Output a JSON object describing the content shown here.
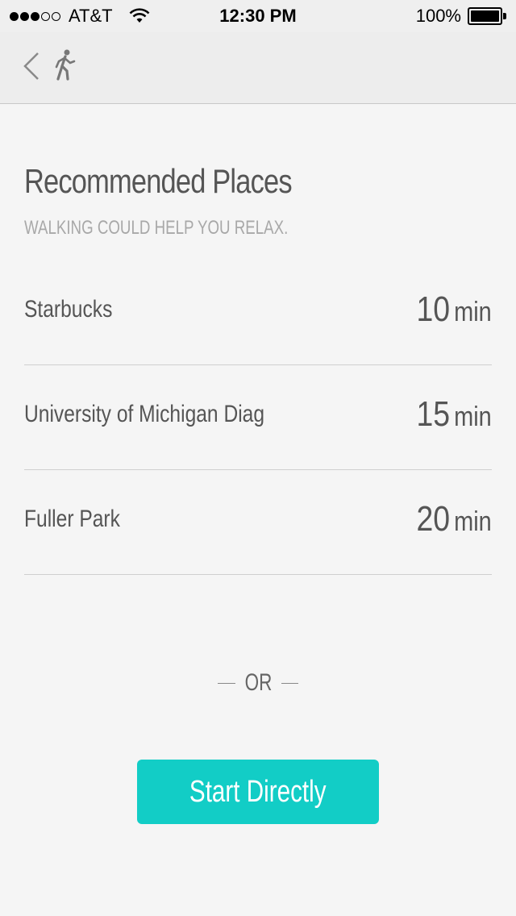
{
  "status_bar": {
    "carrier": "AT&T",
    "time": "12:30 PM",
    "battery": "100%"
  },
  "header": {
    "title": "Recommended Places",
    "subtitle": "WALKING COULD HELP YOU RELAX."
  },
  "places": [
    {
      "name": "Starbucks",
      "time": "10",
      "unit": "min"
    },
    {
      "name": "University of Michigan Diag",
      "time": "15",
      "unit": "min"
    },
    {
      "name": "Fuller Park",
      "time": "20",
      "unit": "min"
    }
  ],
  "divider_label": "OR",
  "start_button_label": "Start Directly",
  "colors": {
    "accent": "#12cdc6",
    "background": "#f5f5f5",
    "nav_background": "#ededed"
  },
  "icons": {
    "back": "chevron-left-icon",
    "activity": "walking-person-icon",
    "wifi": "wifi-icon",
    "battery": "battery-icon"
  }
}
